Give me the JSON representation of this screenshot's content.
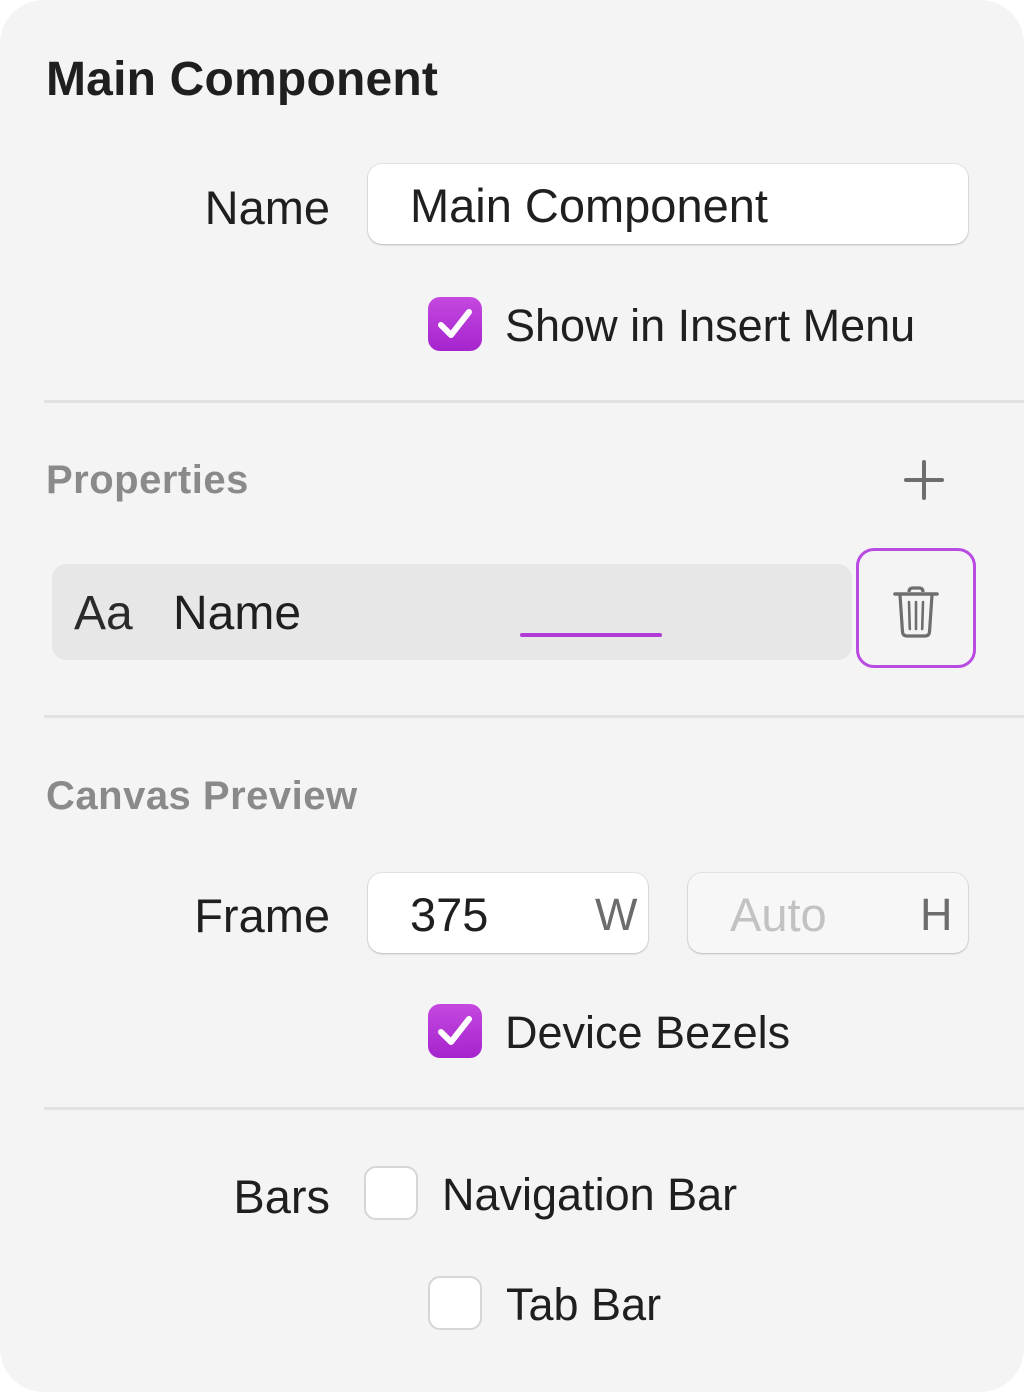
{
  "header": {
    "title": "Main Component"
  },
  "name_row": {
    "label": "Name",
    "value": "Main Component"
  },
  "insert_menu": {
    "label": "Show in Insert Menu",
    "checked": true
  },
  "properties": {
    "title": "Properties",
    "add_icon": "plus-icon",
    "items": [
      {
        "type_icon_text": "Aa",
        "name": "Name",
        "delete_icon": "trash-icon"
      }
    ]
  },
  "canvas_preview": {
    "title": "Canvas Preview",
    "frame": {
      "label": "Frame",
      "width_value": "375",
      "width_suffix": "W",
      "height_placeholder": "Auto",
      "height_suffix": "H"
    },
    "device_bezels": {
      "label": "Device Bezels",
      "checked": true
    }
  },
  "bars": {
    "label": "Bars",
    "navigation_bar": {
      "label": "Navigation Bar",
      "checked": false
    },
    "tab_bar": {
      "label": "Tab Bar",
      "checked": false
    }
  },
  "colors": {
    "accent": "#b03bd8",
    "panel_background": "#f4f4f4",
    "section_title": "#8a8a8a"
  }
}
